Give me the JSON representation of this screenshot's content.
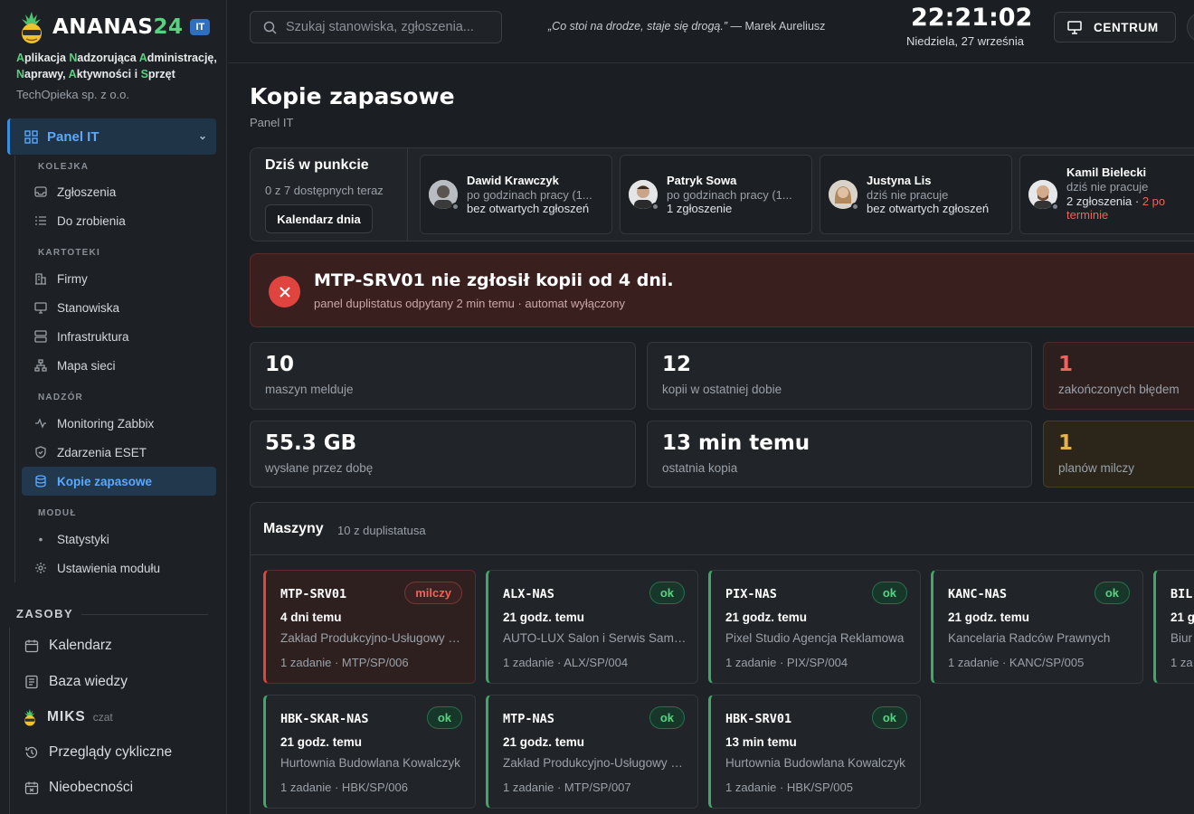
{
  "brand": {
    "name_a": "ANANAS",
    "name_b": "24",
    "badge": "IT",
    "tag_a1": "A",
    "tag_a2": "plikacja ",
    "tag_b1": "N",
    "tag_b2": "adzorująca ",
    "tag_c1": "A",
    "tag_c2": "dministrację,",
    "tag_d1": "N",
    "tag_d2": "aprawy, ",
    "tag_e1": "A",
    "tag_e2": "ktywności i ",
    "tag_f1": "S",
    "tag_f2": "przęt",
    "company": "TechOpieka sp. z o.o."
  },
  "nav": {
    "main": "Panel IT",
    "sections": {
      "kolejka": "KOLEJKA",
      "kartoteki": "KARTOTEKI",
      "nadzor": "NADZÓR",
      "modul": "MODUŁ"
    },
    "items": {
      "zgloszenia": "Zgłoszenia",
      "dozrobienia": "Do zrobienia",
      "firmy": "Firmy",
      "stanowiska": "Stanowiska",
      "infrastruktura": "Infrastruktura",
      "mapa": "Mapa sieci",
      "zabbix": "Monitoring Zabbix",
      "eset": "Zdarzenia ESET",
      "kopie": "Kopie zapasowe",
      "statystyki": "Statystyki",
      "ustawienia": "Ustawienia modułu"
    },
    "zasoby": "ZASOBY",
    "resources": {
      "kalendarz": "Kalendarz",
      "baza": "Baza wiedzy",
      "miks": "MIKS",
      "miks_note": "czat",
      "przeglady": "Przeglądy cykliczne",
      "nieobecnosci": "Nieobecności"
    }
  },
  "topbar": {
    "search_placeholder": "Szukaj stanowiska, zgłoszenia...",
    "quote": "„Co stoi na drodze, staje się drogą.”",
    "quote_author": " — Marek Aureliusz",
    "clock": "22:21:02",
    "date": "Niedziela, 27 września",
    "centrum": "CENTRUM"
  },
  "page": {
    "title": "Kopie zapasowe",
    "crumb": "Panel IT"
  },
  "today": {
    "title": "Dziś w punkcie",
    "sub": "0 z 7 dostępnych teraz",
    "button": "Kalendarz dnia",
    "people": [
      {
        "name": "Dawid Krawczyk",
        "status": "po godzinach pracy (1...",
        "info": "bez otwartych zgłoszeń"
      },
      {
        "name": "Patryk Sowa",
        "status": "po godzinach pracy (1...",
        "info": "1 zgłoszenie"
      },
      {
        "name": "Justyna Lis",
        "status": "dziś nie pracuje",
        "info": "bez otwartych zgłoszeń"
      },
      {
        "name": "Kamil Bielecki",
        "status": "dziś nie pracuje",
        "info": "2 zgłoszenia · ",
        "info_warn": "2 po",
        "info_warn2": "terminie"
      }
    ]
  },
  "alert": {
    "title": "MTP-SRV01 nie zgłosił kopii od 4 dni.",
    "sub": "panel duplistatus odpytany 2 min temu · automat wyłączony",
    "color": "#e0443e"
  },
  "stats": [
    {
      "value": "10",
      "label": "maszyn melduje"
    },
    {
      "value": "12",
      "label": "kopii w ostatniej dobie"
    },
    {
      "value": "1",
      "label": "zakończonych błędem"
    },
    {
      "value": "55.3 GB",
      "label": "wysłane przez dobę"
    },
    {
      "value": "13 min temu",
      "label": "ostatnia kopia"
    },
    {
      "value": "1",
      "label": "planów milczy"
    }
  ],
  "machines": {
    "title": "Maszyny",
    "sub": "10 z duplistatusa",
    "cards": [
      {
        "name": "MTP-SRV01",
        "status": "milczy",
        "time": "4 dni temu",
        "company": "Zakład Produkcyjno-Usługowy Kowalczyk",
        "jobs": "1 zadanie · MTP/SP/006"
      },
      {
        "name": "ALX-NAS",
        "status": "ok",
        "time": "21 godz. temu",
        "company": "AUTO-LUX Salon i Serwis Samochodów",
        "jobs": "1 zadanie · ALX/SP/004"
      },
      {
        "name": "PIX-NAS",
        "status": "ok",
        "time": "21 godz. temu",
        "company": "Pixel Studio Agencja Reklamowa",
        "jobs": "1 zadanie · PIX/SP/004"
      },
      {
        "name": "KANC-NAS",
        "status": "ok",
        "time": "21 godz. temu",
        "company": "Kancelaria Radców Prawnych",
        "jobs": "1 zadanie · KANC/SP/005"
      },
      {
        "name": "BIL-",
        "status": "",
        "time": "21 g",
        "company": "Biur",
        "jobs": "1 za"
      },
      {
        "name": "HBK-SKAR-NAS",
        "status": "ok",
        "time": "21 godz. temu",
        "company": "Hurtownia Budowlana Kowalczyk",
        "jobs": "1 zadanie · HBK/SP/006"
      },
      {
        "name": "MTP-NAS",
        "status": "ok",
        "time": "21 godz. temu",
        "company": "Zakład Produkcyjno-Usługowy Kowalczyk",
        "jobs": "1 zadanie · MTP/SP/007"
      },
      {
        "name": "HBK-SRV01",
        "status": "ok",
        "time": "13 min temu",
        "company": "Hurtownia Budowlana Kowalczyk",
        "jobs": "1 zadanie · HBK/SP/005"
      }
    ]
  }
}
